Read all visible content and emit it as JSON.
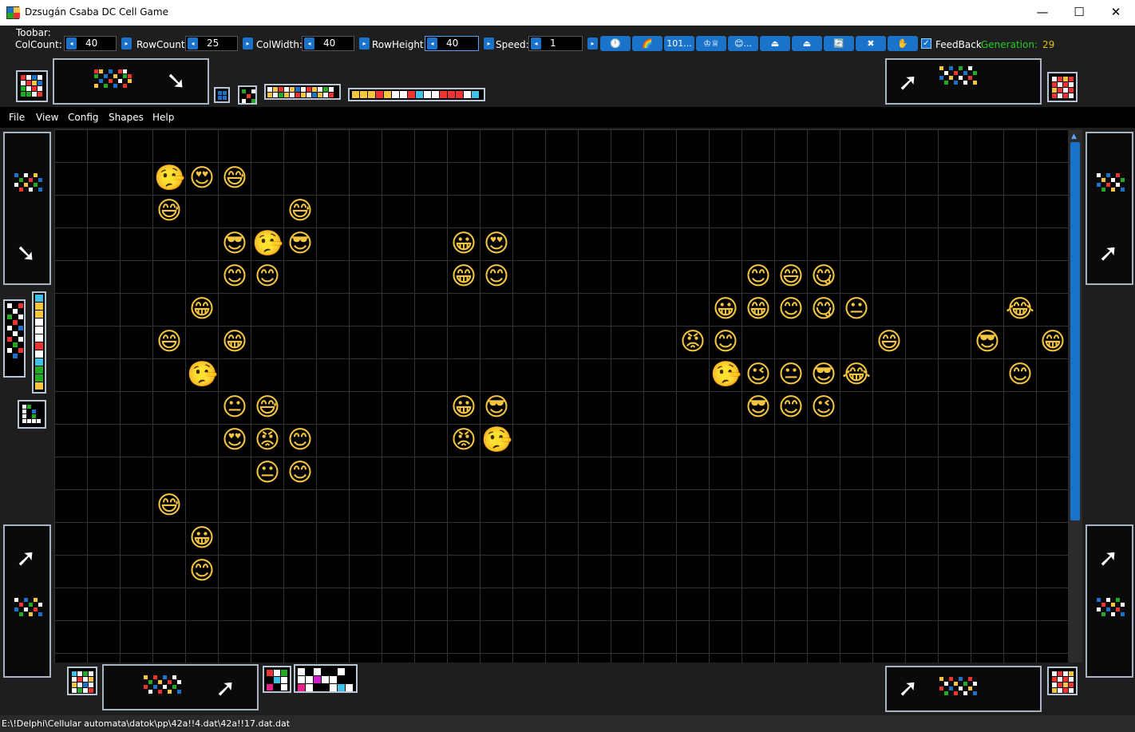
{
  "window": {
    "title": "Dzsugán Csaba  DC Cell Game",
    "min": "—",
    "max": "☐",
    "close": "✕"
  },
  "toolbar": {
    "caption": "Toobar:",
    "colcount_label": "ColCount:",
    "colcount": "40",
    "rowcount_label": "RowCount:",
    "rowcount": "25",
    "colwidth_label": "ColWidth:",
    "colwidth": "40",
    "rowheight_label": "RowHeight:",
    "rowheight": "40",
    "speed_label": "Speed:",
    "speed": "1",
    "buttons": [
      "🕛",
      "🌈",
      "101...",
      "♔♕",
      "😊...",
      "⏏",
      "⏏",
      "🔄",
      "✖",
      "✋"
    ],
    "feedback_label": "FeedBack",
    "feedback_checked": true,
    "generation_label": "Generation:",
    "generation": "29",
    "generation_label_color": "#22cc22",
    "generation_value_color": "#e0c000"
  },
  "menu": [
    "File",
    "View",
    "Config",
    "Shapes",
    "Help"
  ],
  "status": {
    "path": "E:\\!Delphi\\Cellular automata\\datok\\pp\\42a!!4.dat\\42a!!17.dat.dat"
  },
  "arrows": {
    "tl": "➘",
    "tr": "➚",
    "lt": "➘",
    "rt": "➚",
    "lb": "➚",
    "rb": "➚",
    "bl": "➚",
    "br": "➚"
  },
  "cells": [
    [
      "🤥",
      3,
      1
    ],
    [
      "😍",
      4,
      1
    ],
    [
      "😅",
      5,
      1
    ],
    [
      "😅",
      3,
      2
    ],
    [
      "😅",
      7,
      2
    ],
    [
      "😎",
      5,
      3
    ],
    [
      "🤥",
      6,
      3
    ],
    [
      "😎",
      7,
      3
    ],
    [
      "😀",
      12,
      3
    ],
    [
      "😍",
      13,
      3
    ],
    [
      "😊",
      5,
      4
    ],
    [
      "😊",
      6,
      4
    ],
    [
      "😁",
      12,
      4
    ],
    [
      "😊",
      13,
      4
    ],
    [
      "😊",
      21,
      4
    ],
    [
      "😄",
      22,
      4
    ],
    [
      "😋",
      23,
      4
    ],
    [
      "😁",
      4,
      5
    ],
    [
      "😀",
      20,
      5
    ],
    [
      "😁",
      21,
      5
    ],
    [
      "😊",
      22,
      5
    ],
    [
      "😋",
      23,
      5
    ],
    [
      "😐",
      24,
      5
    ],
    [
      "😂",
      29,
      5
    ],
    [
      "😄",
      3,
      6
    ],
    [
      "😁",
      5,
      6
    ],
    [
      "😡",
      19,
      6
    ],
    [
      "😊",
      20,
      6
    ],
    [
      "😄",
      25,
      6
    ],
    [
      "😎",
      28,
      6
    ],
    [
      "😁",
      30,
      6
    ],
    [
      "🤥",
      4,
      7
    ],
    [
      "🤥",
      20,
      7
    ],
    [
      "😉",
      21,
      7
    ],
    [
      "😐",
      22,
      7
    ],
    [
      "😎",
      23,
      7
    ],
    [
      "😂",
      24,
      7
    ],
    [
      "😊",
      29,
      7
    ],
    [
      "😐",
      5,
      8
    ],
    [
      "😅",
      6,
      8
    ],
    [
      "😀",
      12,
      8
    ],
    [
      "😎",
      13,
      8
    ],
    [
      "😎",
      21,
      8
    ],
    [
      "😊",
      22,
      8
    ],
    [
      "😉",
      23,
      8
    ],
    [
      "😍",
      5,
      9
    ],
    [
      "😡",
      6,
      9
    ],
    [
      "😊",
      7,
      9
    ],
    [
      "😡",
      12,
      9
    ],
    [
      "🤥",
      13,
      9
    ],
    [
      "😐",
      6,
      10
    ],
    [
      "😊",
      7,
      10
    ],
    [
      "😅",
      3,
      11
    ],
    [
      "😀",
      4,
      12
    ],
    [
      "😊",
      4,
      13
    ]
  ],
  "colors": {
    "accent": "#1a73c8",
    "grid": "#333333",
    "background": "#1e1e1e"
  }
}
